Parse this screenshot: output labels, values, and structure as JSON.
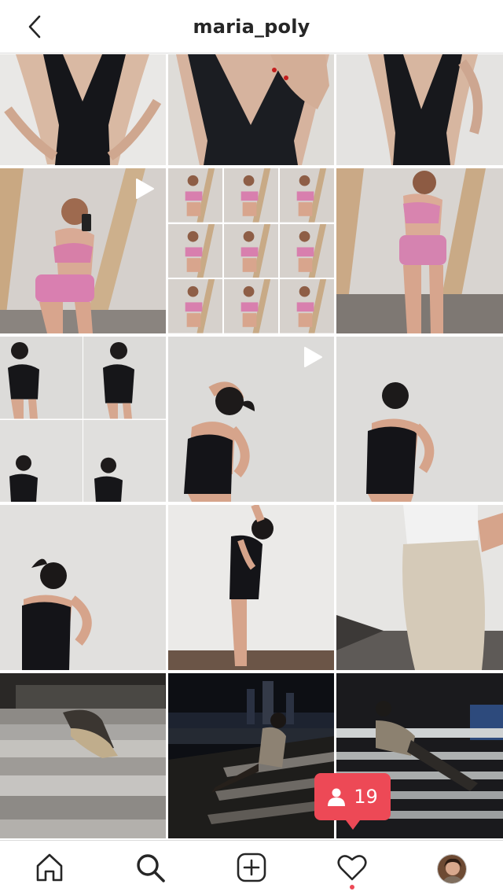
{
  "header": {
    "username": "maria_poly",
    "back_icon": "chevron-left-icon"
  },
  "grid": {
    "posts": [
      {
        "kind": "photo",
        "subject": "black-dress",
        "video": false
      },
      {
        "kind": "photo",
        "subject": "black-dress",
        "video": false
      },
      {
        "kind": "photo",
        "subject": "black-dress",
        "video": false
      },
      {
        "kind": "photo",
        "subject": "pink-set",
        "video": true
      },
      {
        "kind": "collage",
        "subject": "pink-set",
        "video": false
      },
      {
        "kind": "photo",
        "subject": "pink-set",
        "video": false
      },
      {
        "kind": "collage",
        "subject": "black-bodysuit",
        "video": false
      },
      {
        "kind": "photo",
        "subject": "black-bodysuit",
        "video": true
      },
      {
        "kind": "photo",
        "subject": "black-bodysuit",
        "video": false
      },
      {
        "kind": "photo",
        "subject": "black-bodysuit",
        "video": false
      },
      {
        "kind": "photo",
        "subject": "black-dress-back",
        "video": false
      },
      {
        "kind": "photo",
        "subject": "jeans",
        "video": false
      },
      {
        "kind": "photo",
        "subject": "night-stairs",
        "video": false
      },
      {
        "kind": "photo",
        "subject": "night-city",
        "video": false
      },
      {
        "kind": "photo",
        "subject": "night-stairs",
        "video": false
      }
    ]
  },
  "notification": {
    "icon": "person-icon",
    "count": "19",
    "color": "#ed4956"
  },
  "bottom_nav": {
    "items": [
      {
        "name": "home",
        "icon": "home-icon"
      },
      {
        "name": "search",
        "icon": "search-icon"
      },
      {
        "name": "new-post",
        "icon": "plus-square-icon"
      },
      {
        "name": "activity",
        "icon": "heart-icon",
        "badge_dot": true
      },
      {
        "name": "profile",
        "icon": "avatar"
      }
    ]
  }
}
